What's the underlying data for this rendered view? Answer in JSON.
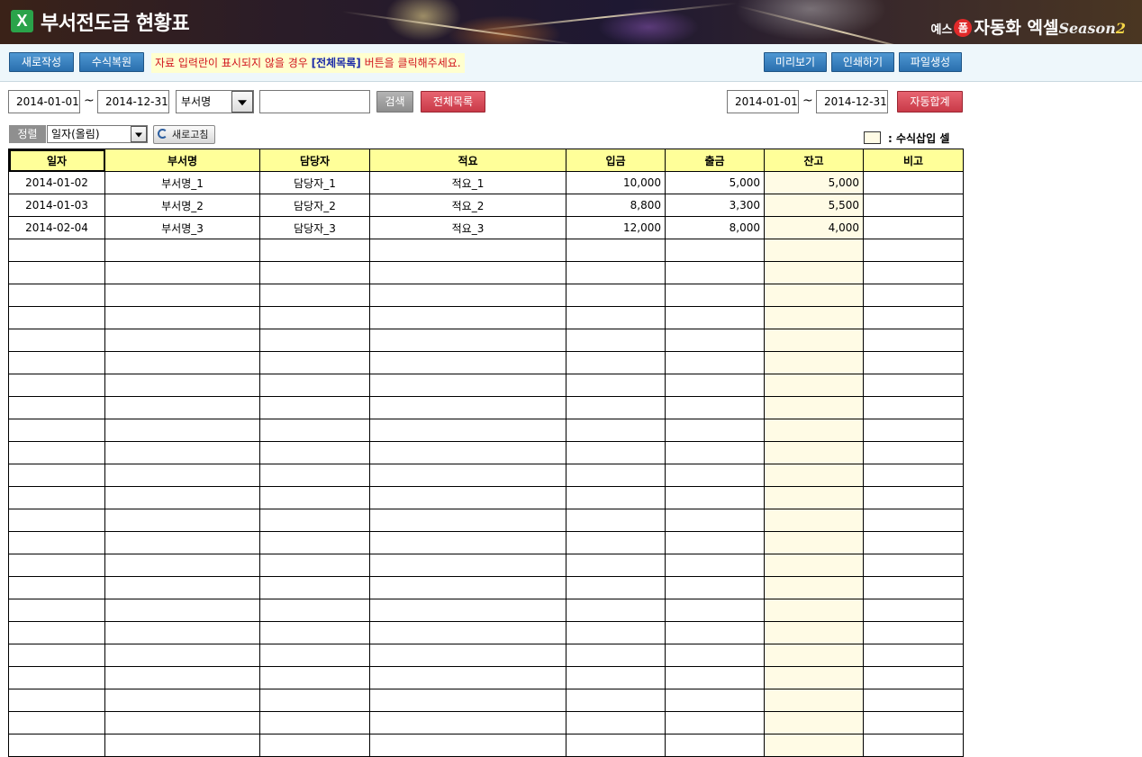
{
  "header": {
    "icon_glyph": "X",
    "title": "부서전도금 현황표",
    "brand_prefix": "예스",
    "brand_badge": "폼",
    "brand_name": "자동화 엑셀",
    "brand_season": "Season",
    "brand_season_num": "2"
  },
  "toolbar": {
    "new_label": "새로작성",
    "restore_label": "수식복원",
    "notice_before": "자료 입력란이 표시되지  않을 경우 ",
    "notice_highlight": "[전체목록]",
    "notice_after": " 버튼을 클릭해주세요.",
    "preview_label": "미리보기",
    "print_label": "인쇄하기",
    "file_label": "파일생성"
  },
  "filter": {
    "start_date": "2014-01-01",
    "tilde": "~",
    "end_date": "2014-12-31",
    "field_select": "부서명",
    "search_value": "",
    "search_label": "검색",
    "all_list_label": "전체목록",
    "sum_start_date": "2014-01-01",
    "sum_end_date": "2014-12-31",
    "auto_sum_label": "자동합계"
  },
  "sort": {
    "label": "정렬",
    "value": "일자(올림)",
    "refresh_label": "새로고침"
  },
  "legend": {
    "text": ": 수식삽입 셀",
    "color": "#fffbe5"
  },
  "table": {
    "headers": [
      "일자",
      "부서명",
      "담당자",
      "적요",
      "입금",
      "출금",
      "잔고",
      "비고"
    ],
    "rows": [
      [
        "2014-01-02",
        "부서명_1",
        "담당자_1",
        "적요_1",
        "10,000",
        "5,000",
        "5,000",
        ""
      ],
      [
        "2014-01-03",
        "부서명_2",
        "담당자_2",
        "적요_2",
        "8,800",
        "3,300",
        "5,500",
        ""
      ],
      [
        "2014-02-04",
        "부서명_3",
        "담당자_3",
        "적요_3",
        "12,000",
        "8,000",
        "4,000",
        ""
      ]
    ],
    "empty_rows": 23
  },
  "colors": {
    "button_blue": "#2a6fae",
    "button_red": "#c93a48",
    "header_yellow": "#ffff99",
    "notice_red": "#d1141e",
    "notice_blue": "#1b2aa8"
  }
}
